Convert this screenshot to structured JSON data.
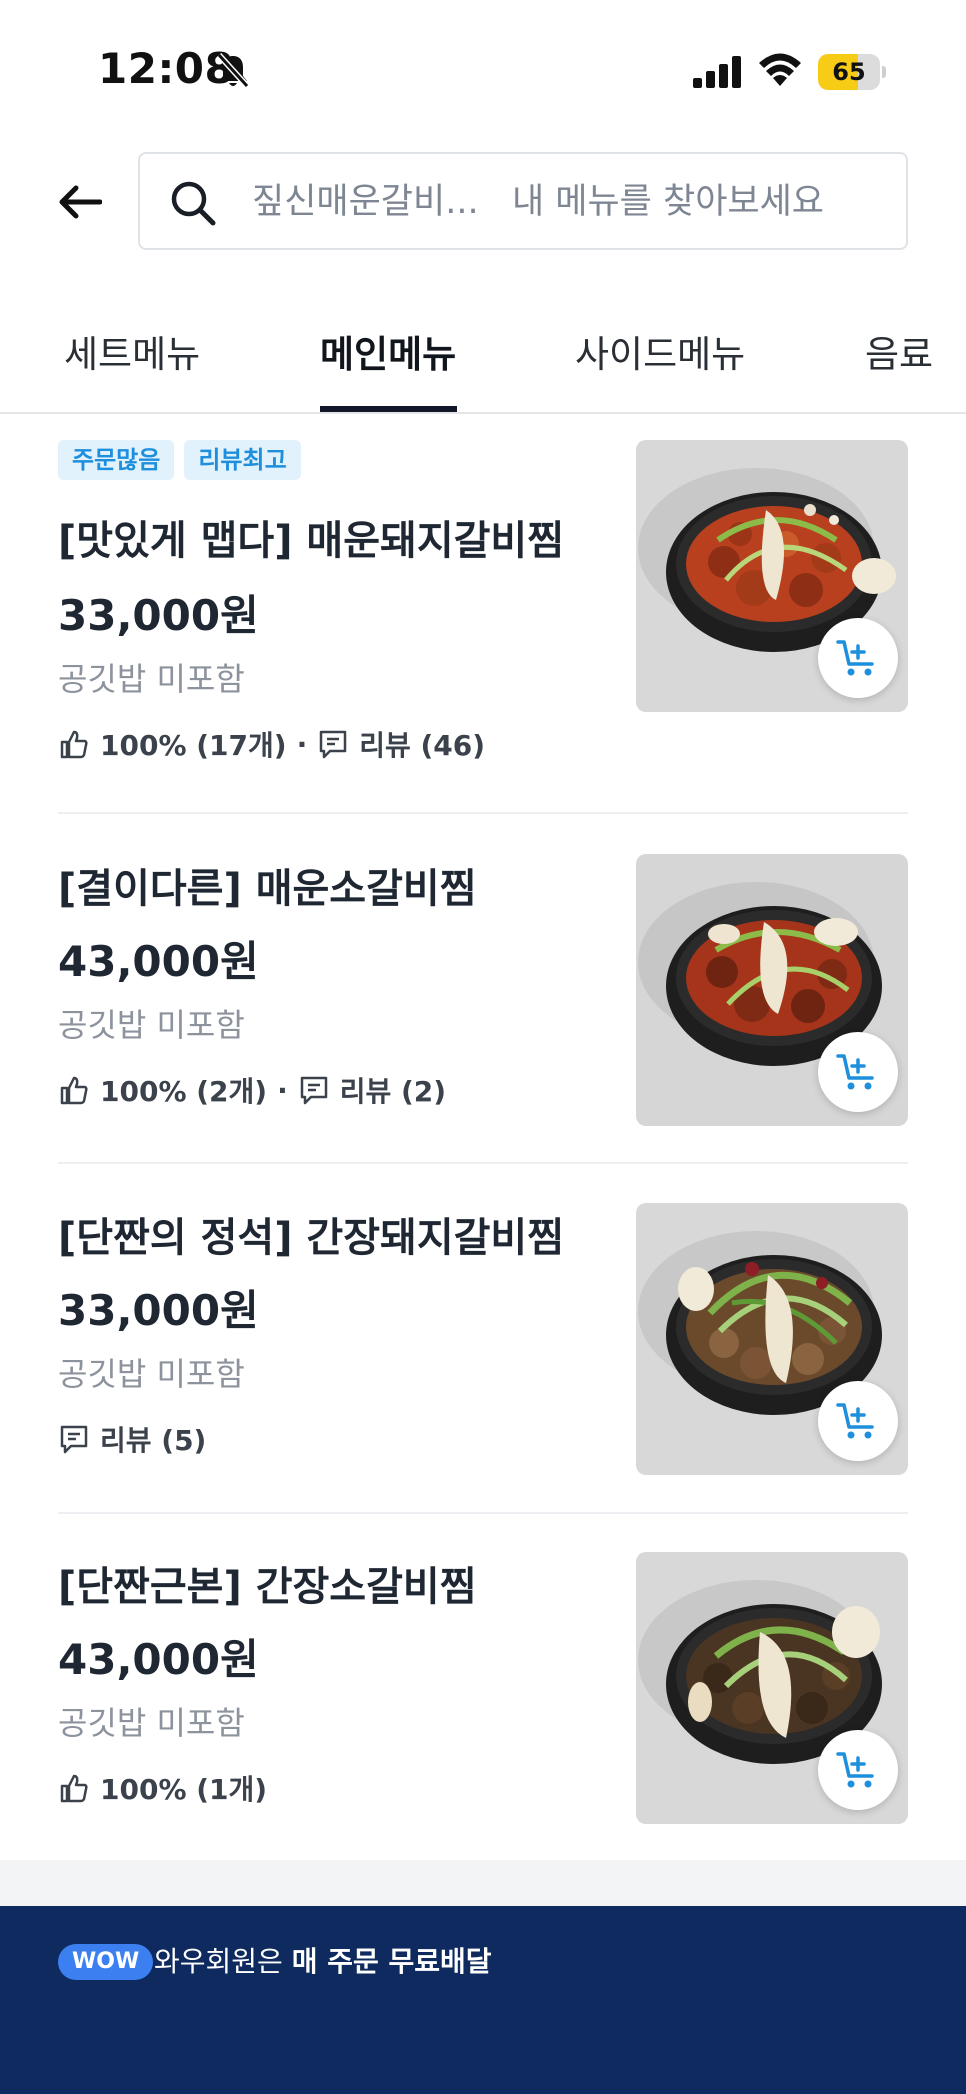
{
  "status_bar": {
    "time": "12:08",
    "battery": "65",
    "battery_level": 0.65,
    "icons": [
      "bell-slash-icon",
      "signal-icon",
      "wifi-icon",
      "battery-icon"
    ]
  },
  "search": {
    "value": "",
    "placeholder": "짚신매운갈비...   내 메뉴를 찾아보세요"
  },
  "tabs": [
    {
      "label": "세트메뉴",
      "active": false
    },
    {
      "label": "메인메뉴",
      "active": true
    },
    {
      "label": "사이드메뉴",
      "active": false
    },
    {
      "label": "음료",
      "active": false
    }
  ],
  "menu_items": [
    {
      "badges": [
        "주문많음",
        "리뷰최고"
      ],
      "name": "[맛있게 맵다] 매운돼지갈비찜",
      "price": "33,000원",
      "note": "공깃밥 미포함",
      "like": "100% (17개)",
      "sep": "·",
      "review": "리뷰 (46)"
    },
    {
      "badges": [],
      "name": " [결이다른] 매운소갈비찜",
      "price": "43,000원",
      "note": "공깃밥 미포함",
      "like": "100% (2개)",
      "sep": "·",
      "review": "리뷰 (2)"
    },
    {
      "badges": [],
      "name": " [단짠의 정석] 간장돼지갈비찜",
      "price": "33,000원",
      "note": "공깃밥 미포함",
      "like": "",
      "sep": "",
      "review": "리뷰 (5)"
    },
    {
      "badges": [],
      "name": " [단짠근본] 간장소갈비찜",
      "price": "43,000원",
      "note": "공깃밥 미포함",
      "like": "100% (1개)",
      "sep": "",
      "review": ""
    }
  ],
  "banner": {
    "badge": "WOW",
    "text_prefix": "와우회원은 ",
    "text_bold": "매 주문 무료배달"
  },
  "colors": {
    "accent_blue": "#1d8fdc",
    "badge_bg": "#e1f2fd",
    "banner_bg": "#0e2a5e",
    "battery_yellow": "#f7cc16"
  }
}
